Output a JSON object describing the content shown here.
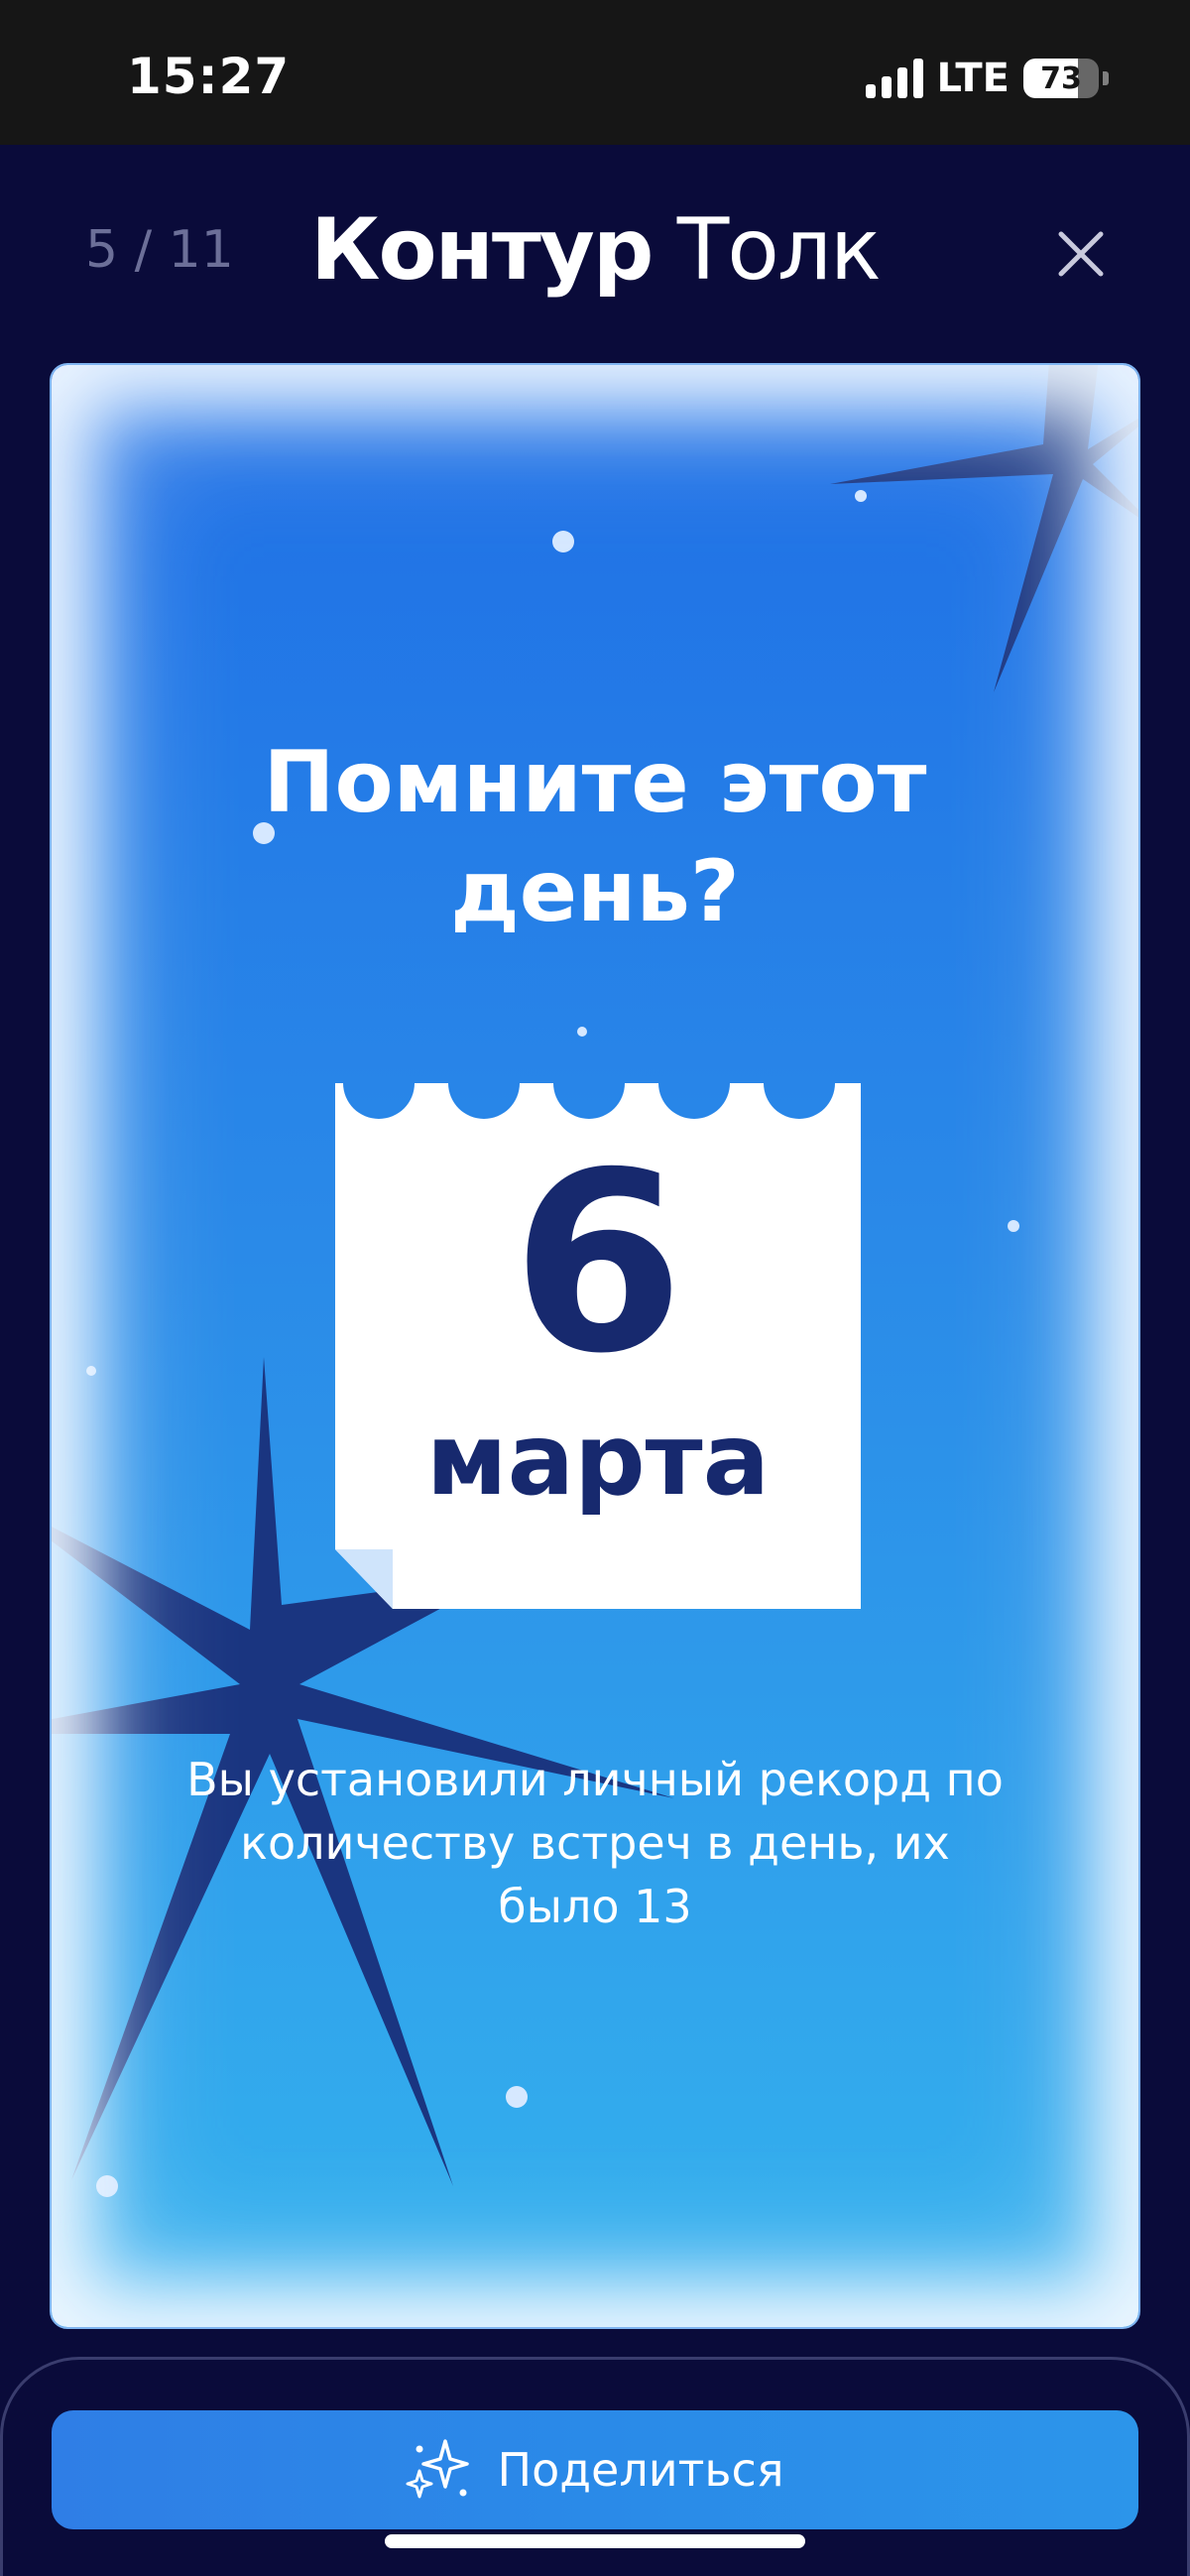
{
  "status_bar": {
    "time": "15:27",
    "network": "LTE",
    "battery": "73",
    "battery_level": 0.73,
    "icons": [
      "signal-icon",
      "battery-icon"
    ]
  },
  "header": {
    "counter": "5 / 11",
    "brand_bold": "Контур",
    "brand_regular": "Толк",
    "close_icon": "close-icon"
  },
  "card": {
    "title": "Помните этот день?",
    "day": "6",
    "month": "марта",
    "description": "Вы установили личный рекорд по количеству встреч в день, их было 13"
  },
  "share": {
    "label": "Поделиться",
    "icon": "sparkles-icon"
  },
  "colors": {
    "background": "#0a0b3a",
    "card_top": "#1f6fe6",
    "card_bottom": "#34b2ee",
    "calendar_text": "#17296e",
    "star": "#1a3580"
  }
}
